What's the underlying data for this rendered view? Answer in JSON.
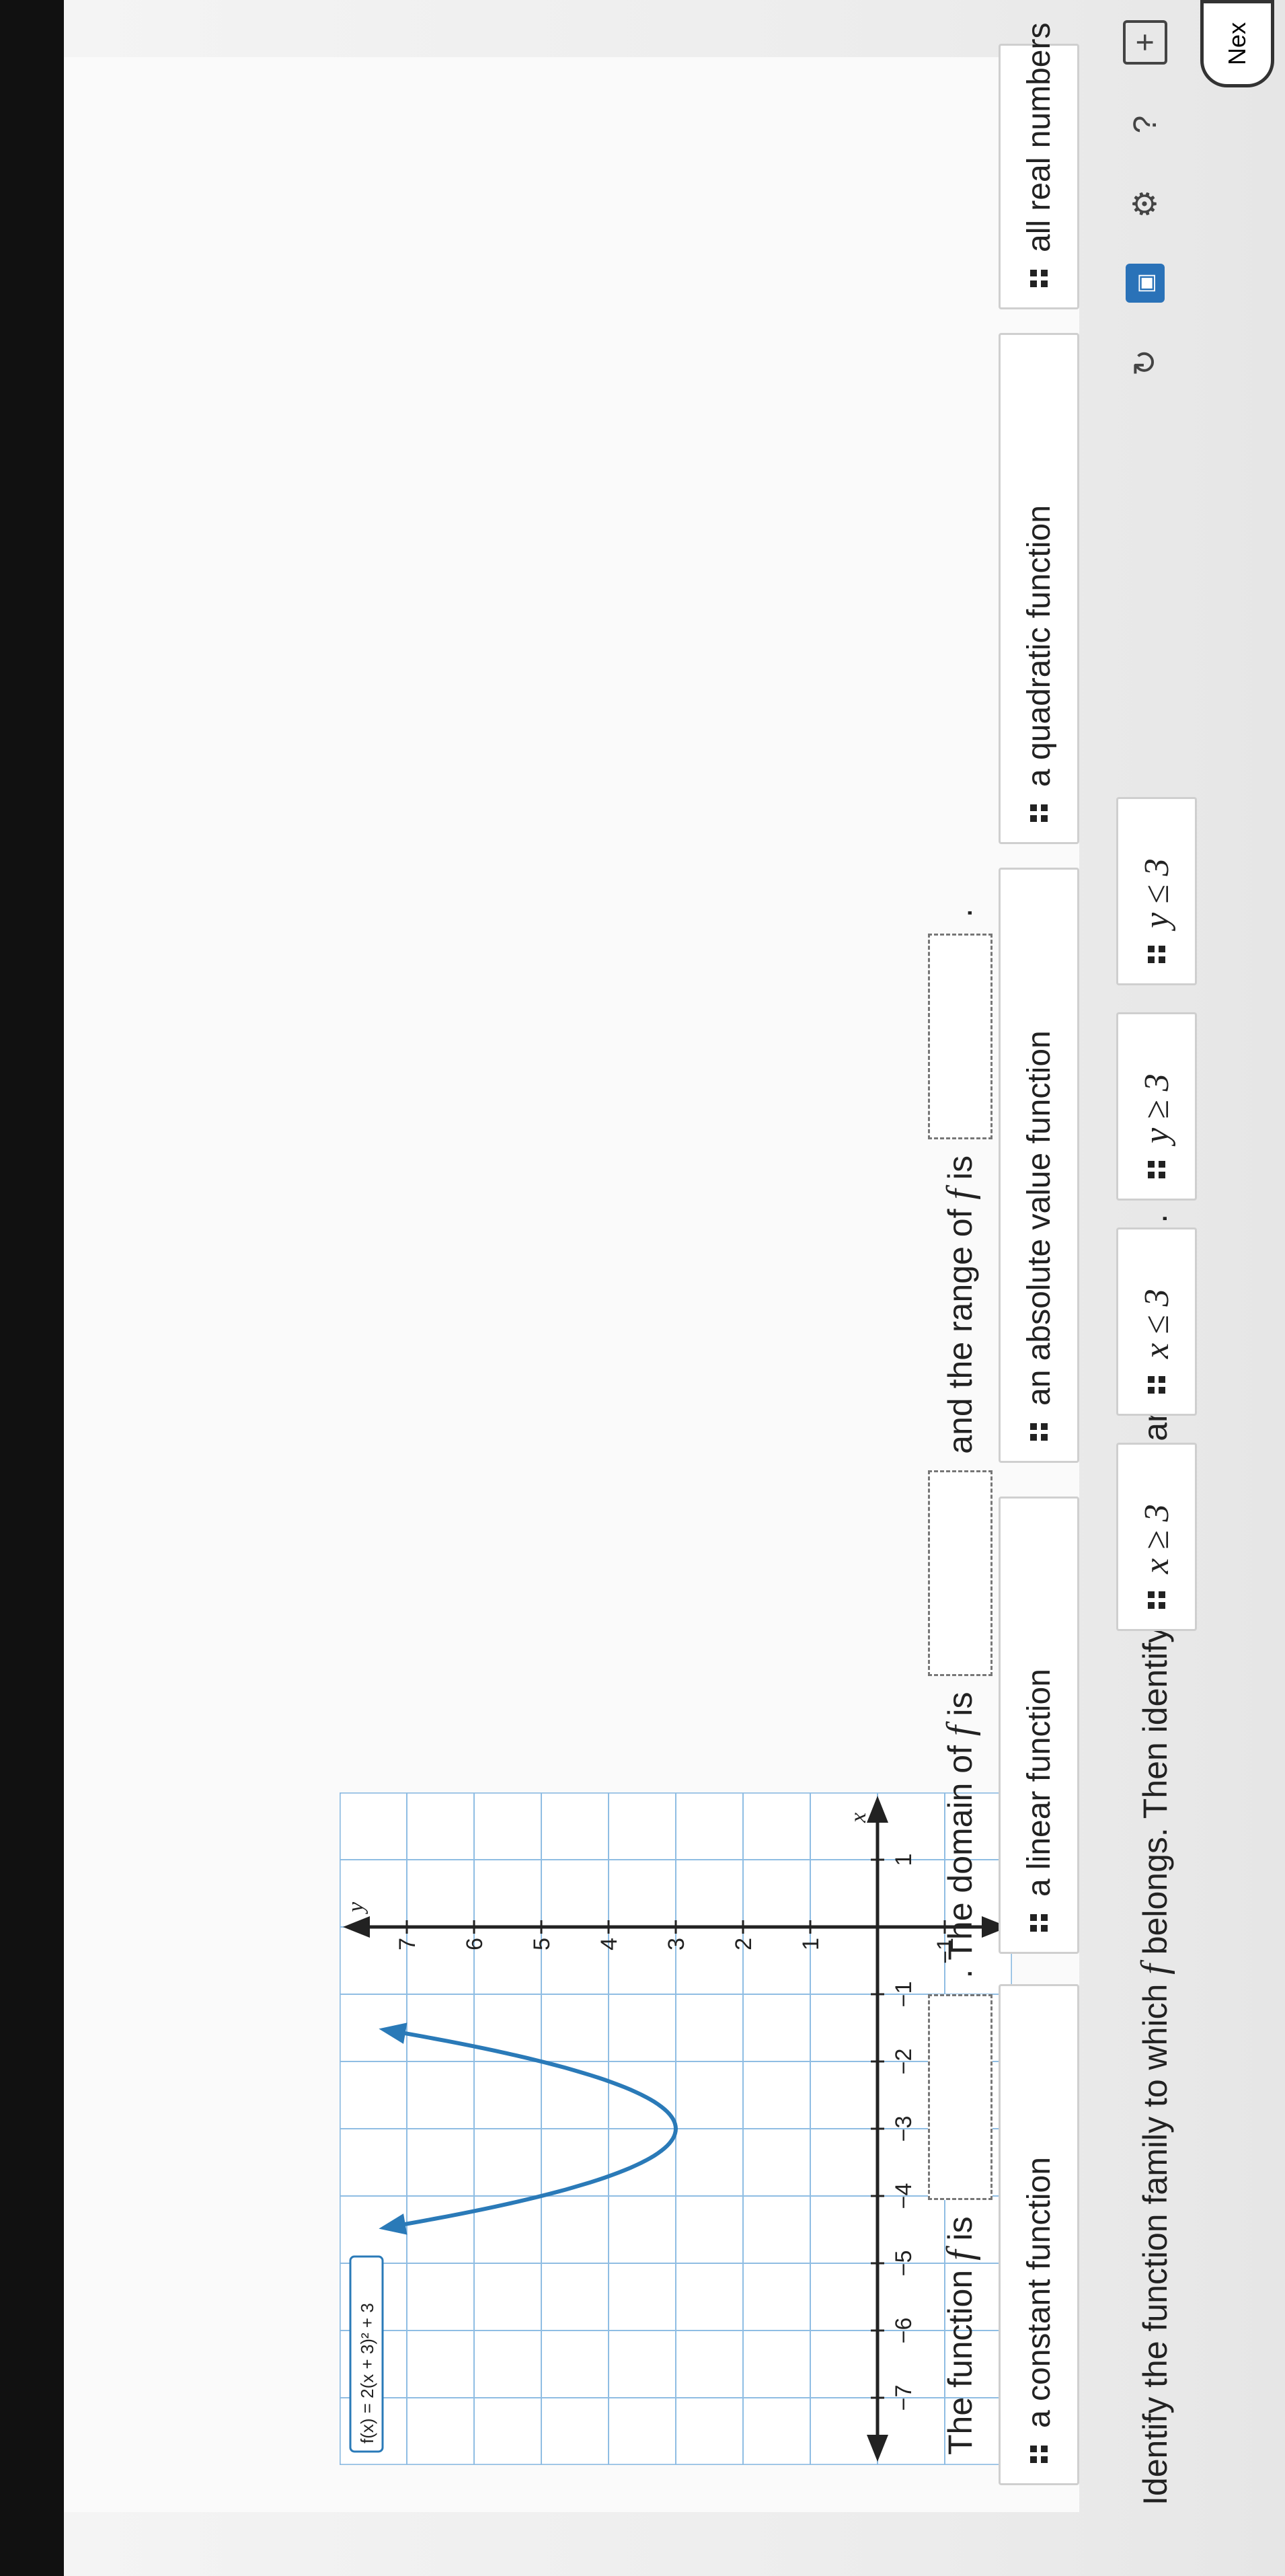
{
  "toolbar": {
    "icons": [
      "refresh-icon",
      "settings-icon",
      "help-icon",
      "document-icon"
    ],
    "next_label": "Nex"
  },
  "question": {
    "prefix": "Identify the function family to which",
    "var1": "f",
    "middle": "belongs. Then identify the domain and range of",
    "var2": "f",
    "suffix": "."
  },
  "graph": {
    "function_label": "f(x) = 2(x + 3)² + 3",
    "x_axis_label": "x",
    "y_axis_label": "y",
    "x_tick_labels": [
      "−7",
      "−6",
      "−5",
      "−4",
      "−3",
      "−2",
      "−1",
      "1"
    ],
    "y_tick_labels": [
      "−1",
      "1",
      "2",
      "3",
      "4",
      "5",
      "6",
      "7"
    ],
    "curve_color": "#2a7ab8"
  },
  "sentence": {
    "part1": "The function",
    "var1": "f",
    "part2": "is",
    "part3": ". The domain of",
    "var2": "f",
    "part4": "is",
    "part5": "and the range of",
    "var3": "f",
    "part6": "is",
    "part7": "."
  },
  "choices": [
    {
      "label": "a constant function"
    },
    {
      "label": "a linear function"
    },
    {
      "label": "an absolute value function"
    },
    {
      "label": "a quadratic function"
    },
    {
      "label": "all real numbers"
    },
    {
      "label": "x ≥ 3"
    },
    {
      "label": "x ≤ 3"
    },
    {
      "label": "y ≥ 3"
    },
    {
      "label": "y ≤ 3"
    }
  ]
}
